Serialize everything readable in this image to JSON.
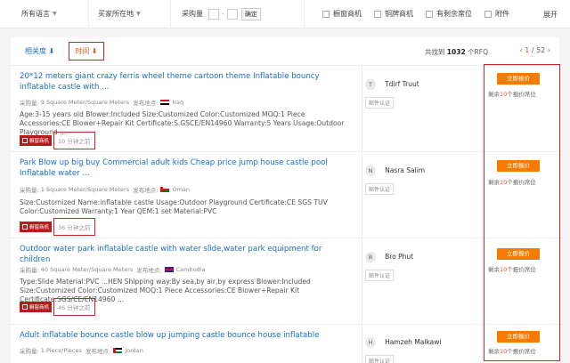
{
  "filters": {
    "language": "所有语言",
    "location": "买家所在地",
    "quantity_label": "采购量",
    "quantity_dash": "-",
    "confirm": "确定",
    "checkboxes": [
      "橱窗商机",
      "铜牌商机",
      "有剩余席位",
      "附件"
    ],
    "expand": "展开"
  },
  "sort": {
    "relevance": "相关度 ⬇",
    "time": "时间 ⬇"
  },
  "results": {
    "found_prefix": "共找到",
    "found_count": "1032",
    "found_suffix": "个RFQ",
    "page_current": "1",
    "page_total": "/ 52"
  },
  "items": [
    {
      "title": "20*12 meters giant crazy ferris wheel theme cartoon theme Inflatable bouncy inflatable castle with ...",
      "qty_label": "采购量:",
      "qty": "9 Square Meter/Square Meters",
      "loc_label": "发布地点:",
      "country": "Iraq",
      "desc": "Age:3-15 years old Blower:Included Size:Customized Color:Customized MOQ:1 Piece Accessories:CE Blower+Repair Kit Certificate:S.GSCE/EN14960 Warranty:5 Years Usage:Outdoor Playground ...",
      "badge": "橱窗商机",
      "ago": "10 分钟之前",
      "buyer_initial": "T",
      "buyer_name": "Tdirf Truut",
      "verify": "邮件认证",
      "quote": "立即报价",
      "remain_prefix": "剩余",
      "remain_n": "10",
      "remain_suffix": "个报价席位"
    },
    {
      "title": "Park Blow up big buy Commercial adult kids Cheap price jump house castle pool Inflatable water ...",
      "qty_label": "采购量:",
      "qty": "1 Square Meter/Square Meters",
      "loc_label": "发布地点:",
      "country": "Oman",
      "desc": "Size:Customized Name:inflatable castle Usage:Outdoor Playground Certificate:CE SGS TUV Color:Customized Warranty:1 Year QEM:1 set Material:PVC",
      "badge": "橱窗商机",
      "ago": "36 分钟之前",
      "buyer_initial": "N",
      "buyer_name": "Nasra Salim",
      "verify": "邮件认证",
      "quote": "立即报价",
      "remain_prefix": "剩余",
      "remain_n": "10",
      "remain_suffix": "个报价席位"
    },
    {
      "title": "Outdoor water park inflatable castle with water slide,water park equipment for children",
      "qty_label": "采购量:",
      "qty": "40 Square Meter/Square Meters",
      "loc_label": "发布地点:",
      "country": "Cambodia",
      "desc": "Type:Slide Material:PVC ...HEN Shipping way:By sea,by air,by express Blower:Included Size:Customized Color:Customized MOQ:1 Piece Accessories:CE Blower+Repair Kit Certificate:SGS/CE/EN14960 ...",
      "badge": "橱窗商机",
      "ago": "46 分钟之前",
      "buyer_initial": "B",
      "buyer_name": "Bro Phut",
      "verify": "邮件认证",
      "quote": "立即报价",
      "remain_prefix": "剩余",
      "remain_n": "10",
      "remain_suffix": "个报价席位"
    },
    {
      "title": "Adult inflatable bounce castle blow up jumping castle bounce house inflatable",
      "qty_label": "采购量:",
      "qty": "1 Piece/Pieces",
      "loc_label": "发布地点:",
      "country": "Jordan",
      "buyer_initial": "H",
      "buyer_name": "Hamzeh Malkawi",
      "verify": "邮件认证",
      "quote": "立即报价",
      "remain_prefix": "剩余",
      "remain_n": "10",
      "remain_suffix": "个报价席位"
    }
  ]
}
